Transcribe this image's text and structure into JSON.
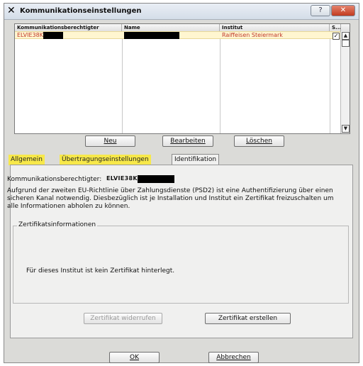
{
  "window": {
    "title": "Kommunikationseinstellungen",
    "help_glyph": "?",
    "close_glyph": "✕",
    "app_glyph": "✕"
  },
  "list": {
    "headers": [
      "Kommunikationsberechtigter",
      "Name",
      "Institut",
      "S..."
    ],
    "rows": [
      {
        "berechtigter": "ELVIE38K",
        "name": "",
        "institut": "Raiffeisen Steiermark",
        "checked": "✓"
      }
    ],
    "scroll_up": "▲",
    "scroll_down": "▼"
  },
  "actions": {
    "new": "Neu",
    "edit": "Bearbeiten",
    "delete": "Löschen"
  },
  "tabs": [
    "Allgemein",
    "Übertragungseinstellungen",
    "Identifikation"
  ],
  "identification": {
    "label": "Kommunikationsberechtigter:",
    "value": "ELVIE38K",
    "paragraph": "Aufgrund der zweiten EU-Richtlinie über Zahlungsdienste (PSD2) ist eine Authentifizierung über einen sicheren Kanal notwendig. Diesbezüglich ist je Installation und Institut ein Zertifikat freizuschalten um alle Informationen abholen zu können.",
    "group_title": "Zertifikatsinformationen",
    "cert_message": "Für dieses Institut ist kein Zertifikat hinterlegt.",
    "revoke_button": "Zertifikat widerrufen",
    "create_button": "Zertifikat erstellen"
  },
  "footer": {
    "ok": "OK",
    "cancel": "Abbrechen"
  }
}
